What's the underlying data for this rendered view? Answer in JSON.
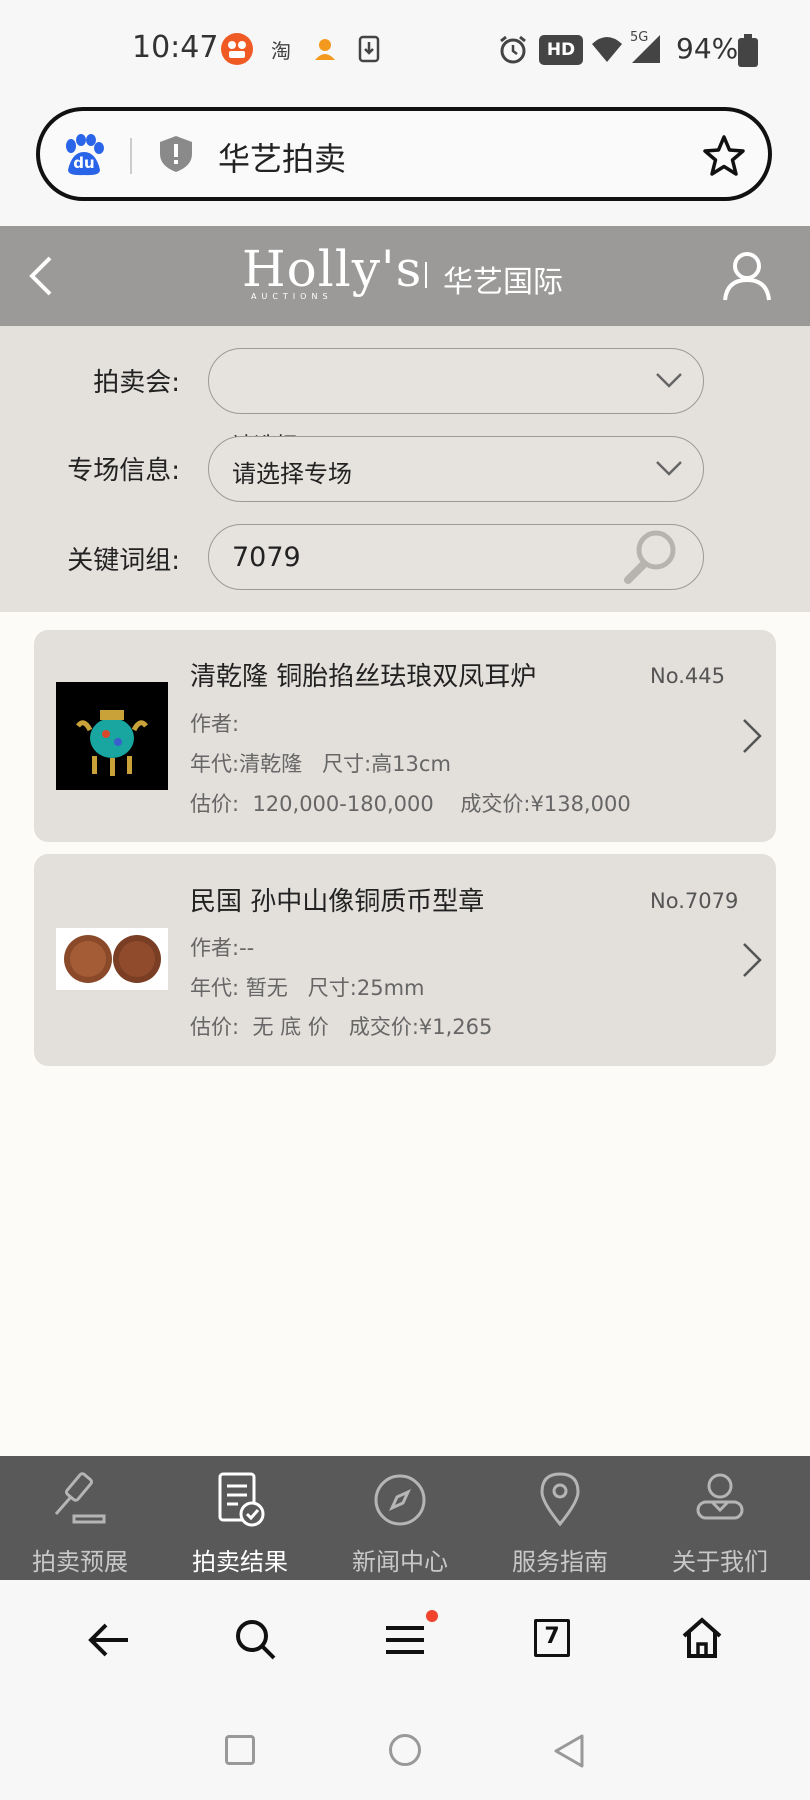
{
  "status_bar": {
    "time": "10:47",
    "app_icons": [
      "video-app-icon",
      "taobao-icon",
      "lottery-app-icon",
      "download-icon"
    ],
    "taobao_glyph": "淘",
    "hd_badge": "HD",
    "network": "5G",
    "battery": "94%"
  },
  "browser": {
    "search_query": "华艺拍卖",
    "baidu_logo_text": "du"
  },
  "site_header": {
    "logo_text": "Holly's",
    "logo_sub": "AUCTIONS",
    "logo_cn": "华艺国际"
  },
  "filters": {
    "auction_label": "拍卖会:",
    "auction_value": "",
    "stray_text": "请选择",
    "session_label": "专场信息:",
    "session_value": "请选择专场",
    "keyword_label": "关键词组:",
    "keyword_value": "7079"
  },
  "results": [
    {
      "title": "清乾隆 铜胎掐丝珐琅双凤耳炉",
      "no": "No.445",
      "author_label": "作者:",
      "author": "",
      "era_label": "年代:",
      "era": "清乾隆",
      "size_label": "尺寸:",
      "size": "高13cm",
      "estimate_label": "估价:",
      "estimate": "120,000-180,000",
      "price_label": "成交价:",
      "price": "¥138,000"
    },
    {
      "title": "民国 孙中山像铜质币型章",
      "no": "No.7079",
      "author_label": "作者:",
      "author": "--",
      "era_label": "年代:",
      "era": "暂无",
      "size_label": "尺寸:",
      "size": "25mm",
      "estimate_label": "估价:",
      "estimate": "无 底 价",
      "price_label": "成交价:",
      "price": "¥1,265"
    }
  ],
  "tabs": [
    {
      "label": "拍卖预展",
      "icon": "gavel-icon",
      "active": false
    },
    {
      "label": "拍卖结果",
      "icon": "result-document-icon",
      "active": true
    },
    {
      "label": "新闻中心",
      "icon": "compass-icon",
      "active": false
    },
    {
      "label": "服务指南",
      "icon": "location-pin-icon",
      "active": false
    },
    {
      "label": "关于我们",
      "icon": "person-icon",
      "active": false
    }
  ],
  "browser_nav": {
    "tab_count": "7"
  },
  "colors": {
    "header_bg": "#9b9a99",
    "filter_bg": "#e4e1dd",
    "card_bg": "#e3e0dc",
    "tab_bar_bg": "#595959",
    "notification_dot": "#f0442c",
    "video_app": "#f05a24",
    "baidu_blue": "#2a64e8"
  }
}
